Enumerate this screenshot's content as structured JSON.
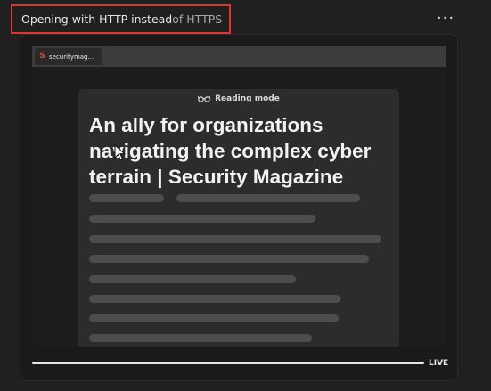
{
  "header": {
    "title_main": "Opening with HTTP instead ",
    "title_dim": "of HTTPS",
    "more_label": "···"
  },
  "preview": {
    "tab_label": "securitymag...",
    "favicon_icon": "security-magazine-favicon",
    "favicon_glyph": "S",
    "reading_mode_icon": "glasses-icon",
    "reading_mode_label": "Reading mode",
    "article_title": "An ally for organizations navigating the complex cyber terrain | Security Magazine"
  },
  "player": {
    "progress": 1.0,
    "live_label": "LIVE"
  },
  "colors": {
    "highlight_border": "#e0352b",
    "background": "#202020",
    "placeholder_line": "#4d4d4d"
  }
}
